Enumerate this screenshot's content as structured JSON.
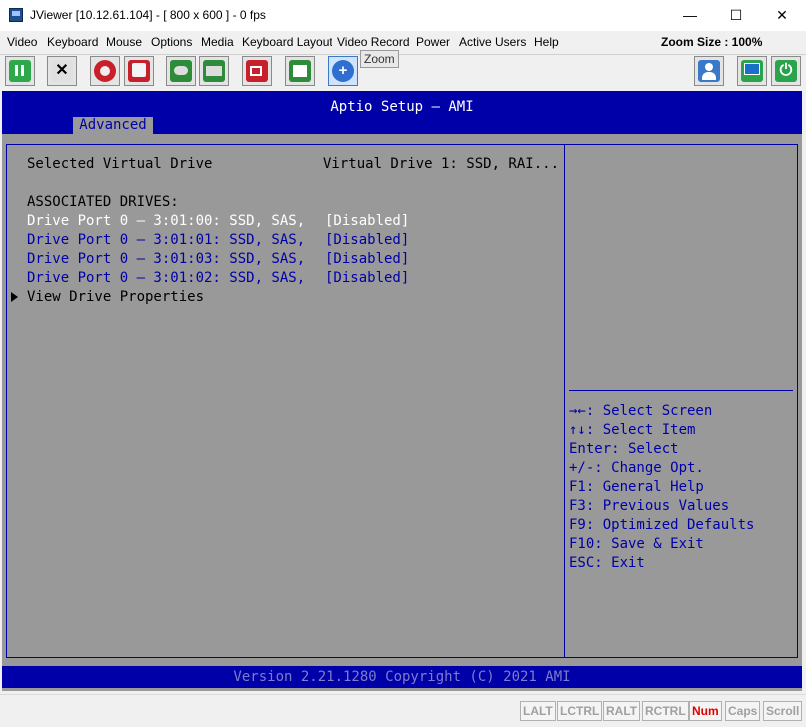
{
  "window": {
    "title": "JViewer [10.12.61.104] - [ 800 x 600 ] - 0 fps",
    "minimize": "—",
    "maximize": "☐",
    "close": "✕"
  },
  "menu": [
    "Video",
    "Keyboard",
    "Mouse",
    "Options",
    "Media",
    "Keyboard Layout",
    "Video Record",
    "Power",
    "Active Users",
    "Help"
  ],
  "zoom_size": "Zoom Size : 100%",
  "tooltip": "Zoom",
  "toolbar_icons": [
    "pause-icon",
    "fullscreen-icon",
    "cdrom-icon",
    "floppy-icon",
    "mouse-icon",
    "keyboard-icon",
    "video-record-icon",
    "macros-icon",
    "zoom-icon",
    "user-icon",
    "display-icon",
    "power-icon"
  ],
  "bios": {
    "title": "Aptio Setup – AMI",
    "tab": "Advanced",
    "selected_label": "Selected Virtual Drive",
    "selected_value": "Virtual Drive 1: SSD, RAI...",
    "assoc_header": "ASSOCIATED DRIVES:",
    "drives": [
      {
        "label": "Drive Port 0 – 3:01:00: SSD, SAS,",
        "value": "[Disabled]"
      },
      {
        "label": "Drive Port 0 – 3:01:01: SSD, SAS,",
        "value": "[Disabled]"
      },
      {
        "label": "Drive Port 0 – 3:01:03: SSD, SAS,",
        "value": "[Disabled]"
      },
      {
        "label": "Drive Port 0 – 3:01:02: SSD, SAS,",
        "value": "[Disabled]"
      }
    ],
    "view_props": "View Drive Properties",
    "help": [
      "→←: Select Screen",
      "↑↓: Select Item",
      "Enter: Select",
      "+/-: Change Opt.",
      "F1: General Help",
      "F3: Previous Values",
      "F9: Optimized Defaults",
      "F10: Save & Exit",
      "ESC: Exit"
    ],
    "footer": "Version 2.21.1280 Copyright (C) 2021 AMI"
  },
  "status_keys": [
    "LALT",
    "LCTRL",
    "RALT",
    "RCTRL",
    "Num",
    "Caps",
    "Scroll"
  ],
  "colors": {
    "bios_blue": "#0000a8",
    "bios_gray": "#999999",
    "num_on": "#e00000"
  }
}
